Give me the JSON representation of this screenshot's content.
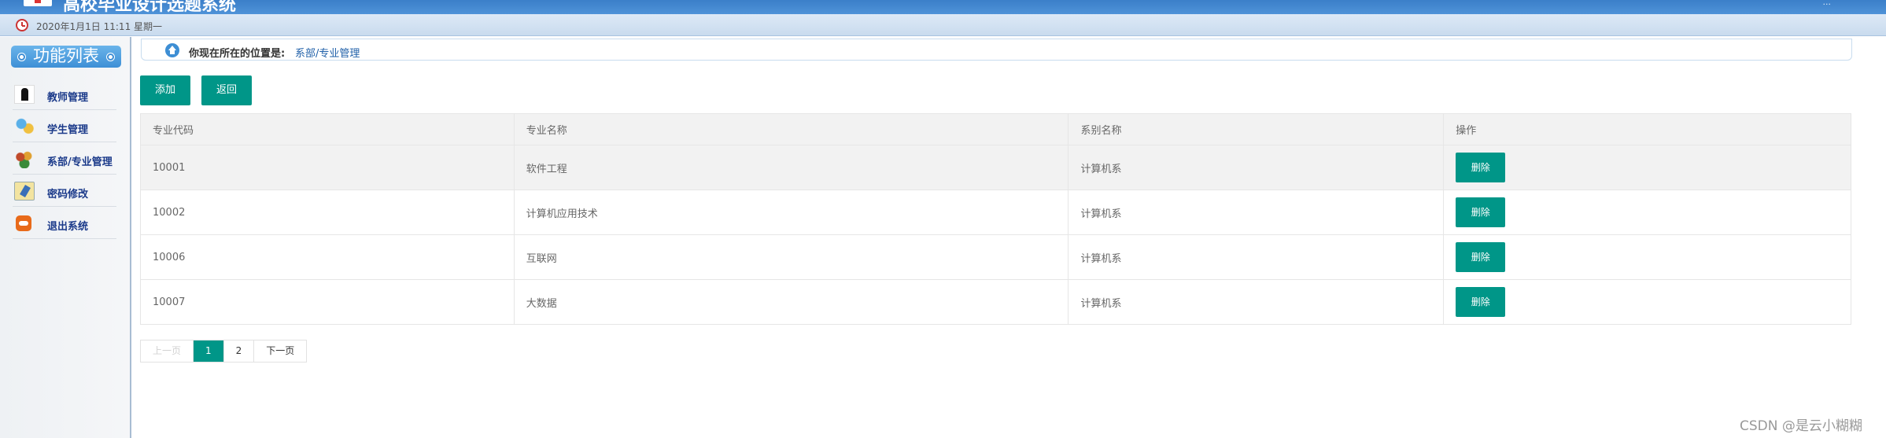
{
  "header": {
    "app_title": "高校毕业设计选题系统",
    "top_right": "..."
  },
  "datebar": {
    "date": "2020年1月1日 11:11 星期一"
  },
  "sidebar": {
    "title": "功能列表",
    "items": [
      {
        "label": "教师管理",
        "icon": "teacher-icon"
      },
      {
        "label": "学生管理",
        "icon": "students-icon"
      },
      {
        "label": "系部/专业管理",
        "icon": "department-icon"
      },
      {
        "label": "密码修改",
        "icon": "password-icon"
      },
      {
        "label": "退出系统",
        "icon": "exit-icon"
      }
    ]
  },
  "breadcrumb": {
    "prefix": "你现在所在的位置是:",
    "location": "系部/专业管理"
  },
  "toolbar": {
    "add_label": "添加",
    "back_label": "返回"
  },
  "table": {
    "headers": [
      "专业代码",
      "专业名称",
      "系别名称",
      "操作"
    ],
    "rows": [
      {
        "code": "10001",
        "name": "软件工程",
        "dept": "计算机系",
        "action": "删除"
      },
      {
        "code": "10002",
        "name": "计算机应用技术",
        "dept": "计算机系",
        "action": "删除"
      },
      {
        "code": "10006",
        "name": "互联网",
        "dept": "计算机系",
        "action": "删除"
      },
      {
        "code": "10007",
        "name": "大数据",
        "dept": "计算机系",
        "action": "删除"
      }
    ]
  },
  "pagination": {
    "prev": "上一页",
    "pages": [
      "1",
      "2"
    ],
    "current": "1",
    "next": "下一页"
  },
  "watermark": "CSDN @是云小糊糊",
  "colors": {
    "primary": "#009688",
    "header": "#4a8fd6",
    "link": "#1f5fa8"
  }
}
